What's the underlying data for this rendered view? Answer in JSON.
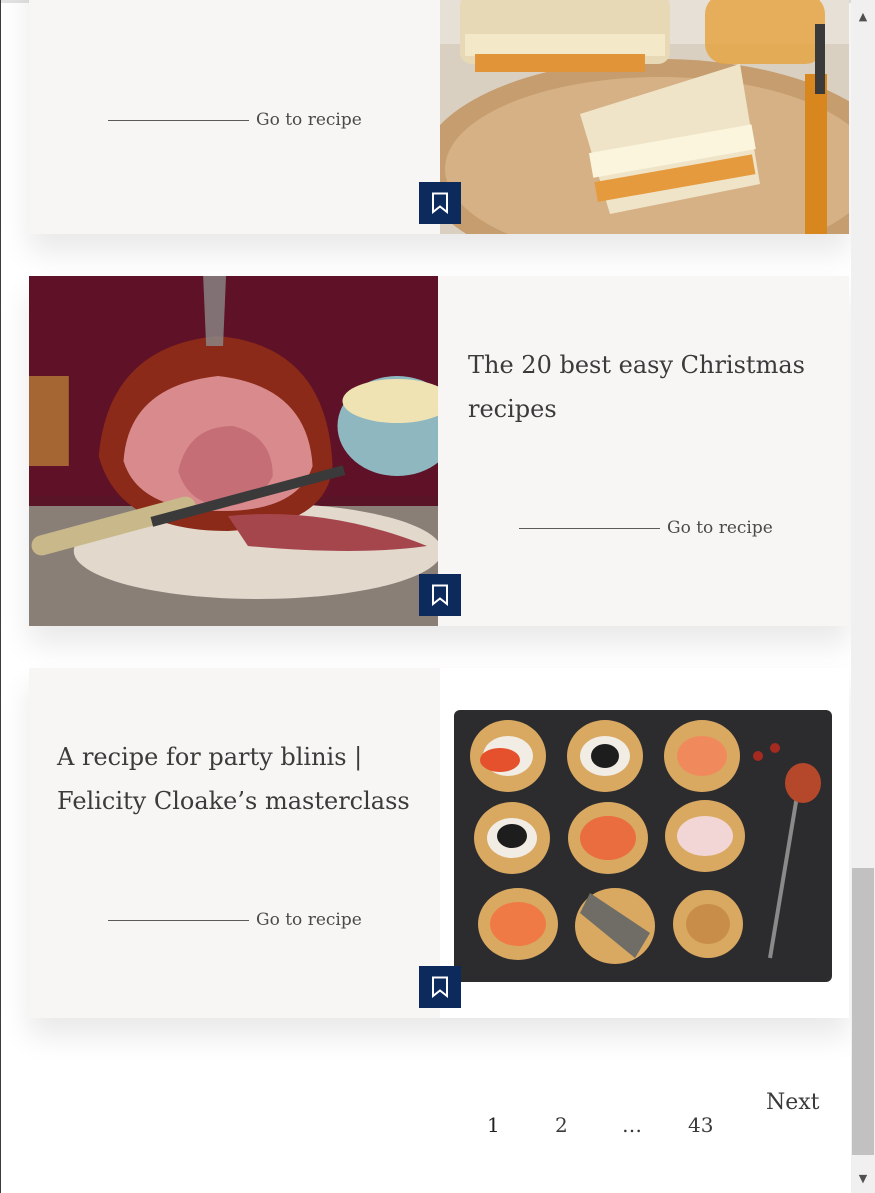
{
  "recipes": [
    {
      "title": "",
      "link_label": "Go to recipe",
      "bookmark_icon": "bookmark-icon",
      "image": "grilled-halloumi-sandwich-photo"
    },
    {
      "title": "The 20 best easy Christmas recipes",
      "link_label": "Go to recipe",
      "bookmark_icon": "bookmark-icon",
      "image": "glazed-ham-photo"
    },
    {
      "title": "A recipe for party blinis | Felicity Cloake’s masterclass",
      "link_label": "Go to recipe",
      "bookmark_icon": "bookmark-icon",
      "image": "party-blinis-photo"
    }
  ],
  "pagination": {
    "pages": [
      "1",
      "2",
      "…",
      "43"
    ],
    "next_label": "Next"
  },
  "colors": {
    "card_background": "#f7f6f4",
    "bookmark_background": "#0d2a5c",
    "text": "#3b3b3b"
  }
}
